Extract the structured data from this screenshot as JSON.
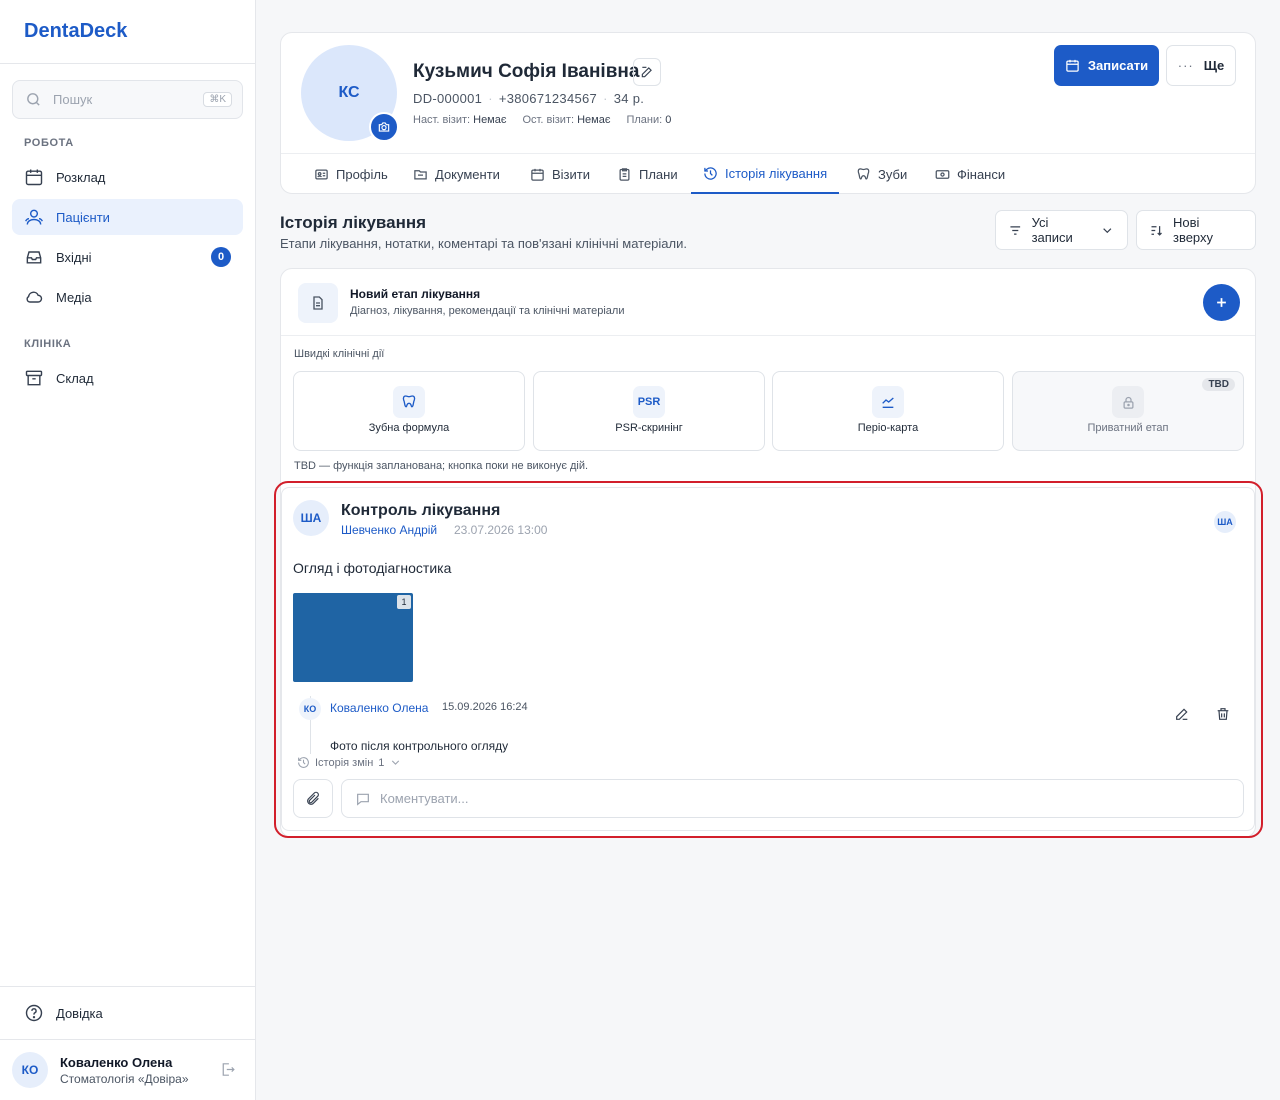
{
  "app": {
    "logo": "DentaDeck"
  },
  "sidebar": {
    "search": {
      "placeholder": "Пошук",
      "shortcut": "⌘K"
    },
    "section_work": "РОБОТА",
    "section_clinic": "КЛІНІКА",
    "items": [
      {
        "label": "Розклад",
        "icon": "calendar-icon"
      },
      {
        "label": "Пацієнти",
        "icon": "users-icon",
        "active": true
      },
      {
        "label": "Вхідні",
        "icon": "inbox-icon",
        "badge": "0"
      },
      {
        "label": "Медіа",
        "icon": "cloud-icon"
      },
      {
        "label": "Склад",
        "icon": "archive-icon"
      }
    ],
    "help": "Довідка",
    "user": {
      "initials": "КО",
      "name": "Коваленко Олена",
      "clinic": "Стоматологія «Довіра»"
    }
  },
  "patient": {
    "initials": "КС",
    "name": "Кузьмич Софія Іванівна",
    "id": "DD-000001",
    "phone": "+380671234567",
    "age": "34 р.",
    "next_visit_label": "Наст. візит:",
    "next_visit_value": "Немає",
    "last_visit_label": "Ост. візит:",
    "last_visit_value": "Немає",
    "plans_label": "Плани:",
    "plans_value": "0",
    "book_button": "Записати",
    "more_button": "Ще"
  },
  "tabs": [
    {
      "label": "Профіль",
      "icon": "id-card-icon"
    },
    {
      "label": "Документи",
      "icon": "folder-icon"
    },
    {
      "label": "Візити",
      "icon": "calendar-icon"
    },
    {
      "label": "Плани",
      "icon": "clipboard-icon"
    },
    {
      "label": "Історія лікування",
      "icon": "history-icon",
      "active": true
    },
    {
      "label": "Зуби",
      "icon": "tooth-icon"
    },
    {
      "label": "Фінанси",
      "icon": "money-icon"
    }
  ],
  "history": {
    "title": "Історія лікування",
    "subtitle": "Етапи лікування, нотатки, коментарі та пов'язані клінічні матеріали.",
    "filter_label": "Усі записи",
    "sort_label": "Нові зверху"
  },
  "new_stage": {
    "title": "Новий етап лікування",
    "subtitle": "Діагноз, лікування, рекомендації та клінічні матеріали",
    "quick_actions_label": "Швидкі клінічні дії",
    "quick_actions": [
      {
        "label": "Зубна формула",
        "icon": "tooth-icon"
      },
      {
        "label": "PSR-скринінг",
        "icon_text": "PSR"
      },
      {
        "label": "Періо-карта",
        "icon": "chart-icon"
      },
      {
        "label": "Приватний етап",
        "icon": "lock-icon",
        "badge": "TBD",
        "disabled": true
      }
    ],
    "tbd_note": "TBD — функція запланована; кнопка поки не виконує дій."
  },
  "entry": {
    "initials": "ША",
    "title": "Контроль лікування",
    "author": "Шевченко Андрій",
    "date": "23.07.2026 13:00",
    "mini_initials": "ША",
    "text": "Огляд і фотодіагностика",
    "photo_count": "1",
    "photo_color": "#1f64a4",
    "comment": {
      "initials": "КО",
      "author": "Коваленко Олена",
      "date": "15.09.2026 16:24",
      "text": "Фото після контрольного огляду"
    },
    "history_label": "Історія змін",
    "history_count": "1",
    "comment_placeholder": "Коментувати..."
  },
  "colors": {
    "accent": "#1d5bc7",
    "highlight": "#d21f2b"
  }
}
